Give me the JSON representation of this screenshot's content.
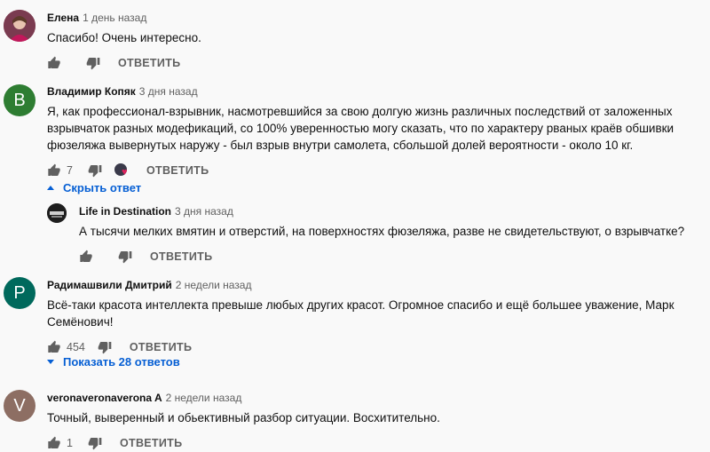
{
  "comments": [
    {
      "author": "Елена",
      "time": "1 день назад",
      "lines": [
        "Спасибо! Очень интересно."
      ],
      "likes": "",
      "reply_label": "ОТВЕТИТЬ",
      "avatar_color": "#a0405a"
    },
    {
      "author": "Владимир Копяк",
      "time": "3 дня назад",
      "lines": [
        "Я, как профессионал-взрывник,  насмотревшийся за свою долгую жизнь различных последствий от заложенных",
        "взрывчаток разных модефикаций, со 100% уверенностью могу сказать, что по характеру рваных краёв обшивки",
        "фюзеляжа вывернутых наружу - был взрыв внутри самолета, сбольшой долей вероятности - около 10 кг."
      ],
      "likes": "7",
      "reply_label": "ОТВЕТИТЬ",
      "avatar_letter": "В",
      "avatar_color": "#2e7d32",
      "toggle_label": "Скрыть ответ",
      "replies": [
        {
          "author": "Life in Destination",
          "time": "3 дня назад",
          "lines": [
            "А тысячи мелких вмятин и отверстий, на поверхностях фюзеляжа, разве не свидетельствуют, о взрывчатке?"
          ],
          "likes": "",
          "reply_label": "ОТВЕТИТЬ",
          "avatar_color": "#2a2a2a"
        }
      ]
    },
    {
      "author": "Радимашвили Дмитрий",
      "time": "2 недели назад",
      "lines": [
        "Всё-таки красота интеллекта превыше любых других красот. Огромное спасибо и ещё большее уважение, Марк",
        "Семёнович!"
      ],
      "likes": "454",
      "reply_label": "ОТВЕТИТЬ",
      "avatar_letter": "P",
      "avatar_color": "#00695c",
      "toggle_label": "Показать 28 ответов"
    },
    {
      "author": "veronaveronaverona A",
      "time": "2 недели назад",
      "lines": [
        "Точный, выверенный и обьективный разбор ситуации. Восхитительно."
      ],
      "likes": "1",
      "reply_label": "ОТВЕТИТЬ",
      "avatar_letter": "V",
      "avatar_color": "#8d6e63"
    }
  ]
}
